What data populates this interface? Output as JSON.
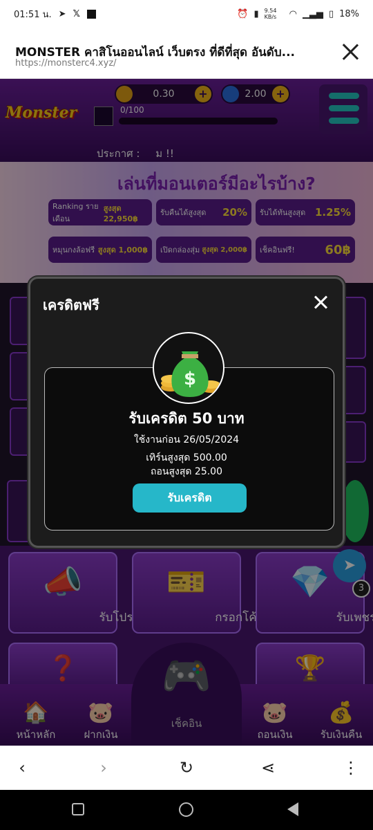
{
  "status_bar": {
    "time": "01:51 น.",
    "network_speed": "9.54 KB/s",
    "battery": "18%"
  },
  "browser": {
    "page_title": "MONSTER คาสิโนออนไลน์ เว็บตรง ที่ดีที่สุด อันดับ...",
    "url": "https://monsterc4.xyz/"
  },
  "site": {
    "coins": "0.30",
    "gems": "2.00",
    "level_progress": "0/100",
    "announcement_label": "ประกาศ :",
    "announcement_text": "ม !!",
    "banner": {
      "title": "เล่นที่มอนเตอร์มีอะไรบ้าง?",
      "promos": [
        {
          "label": "Ranking รายเดือน",
          "value": "สูงสุด 22,950฿"
        },
        {
          "label": "รับคืนได้สูงสุด",
          "value": "20%"
        },
        {
          "label": "รับได้ทันสูงสุด",
          "value": "1.25%"
        },
        {
          "label": "หมุนกงล้อฟรี",
          "value": "สูงสุด 1,000฿"
        },
        {
          "label": "เปิดกล่องสุ่ม",
          "value": "สูงสุด 2,000฿"
        },
        {
          "label": "เช็คอินฟรี!",
          "value": "60฿"
        }
      ]
    },
    "tiles": [
      {
        "label": "รับโปร",
        "icon": "megaphone-icon"
      },
      {
        "label": "กรอกโค้ด",
        "icon": "ticket-icon"
      },
      {
        "label": "รับเพชรฟรี",
        "icon": "gem-icon"
      }
    ],
    "badge_count": "3",
    "bottom_nav": [
      {
        "label": "หน้าหลัก",
        "icon": "home-icon"
      },
      {
        "label": "ฝากเงิน",
        "icon": "deposit-icon"
      },
      {
        "label": "เช็คอิน",
        "icon": "gamepad-icon"
      },
      {
        "label": "ถอนเงิน",
        "icon": "withdraw-icon"
      },
      {
        "label": "รับเงินคืน",
        "icon": "cashback-icon"
      }
    ]
  },
  "modal": {
    "title": "เครดิตฟรี",
    "reward_title": "รับเครดิต 50 บาท",
    "expiry": "ใช้งานก่อน 26/05/2024",
    "max_turn": "เทิร์นสูงสุด 500.00",
    "max_withdraw": "ถอนสูงสุด 25.00",
    "claim_label": "รับเครดิต"
  }
}
